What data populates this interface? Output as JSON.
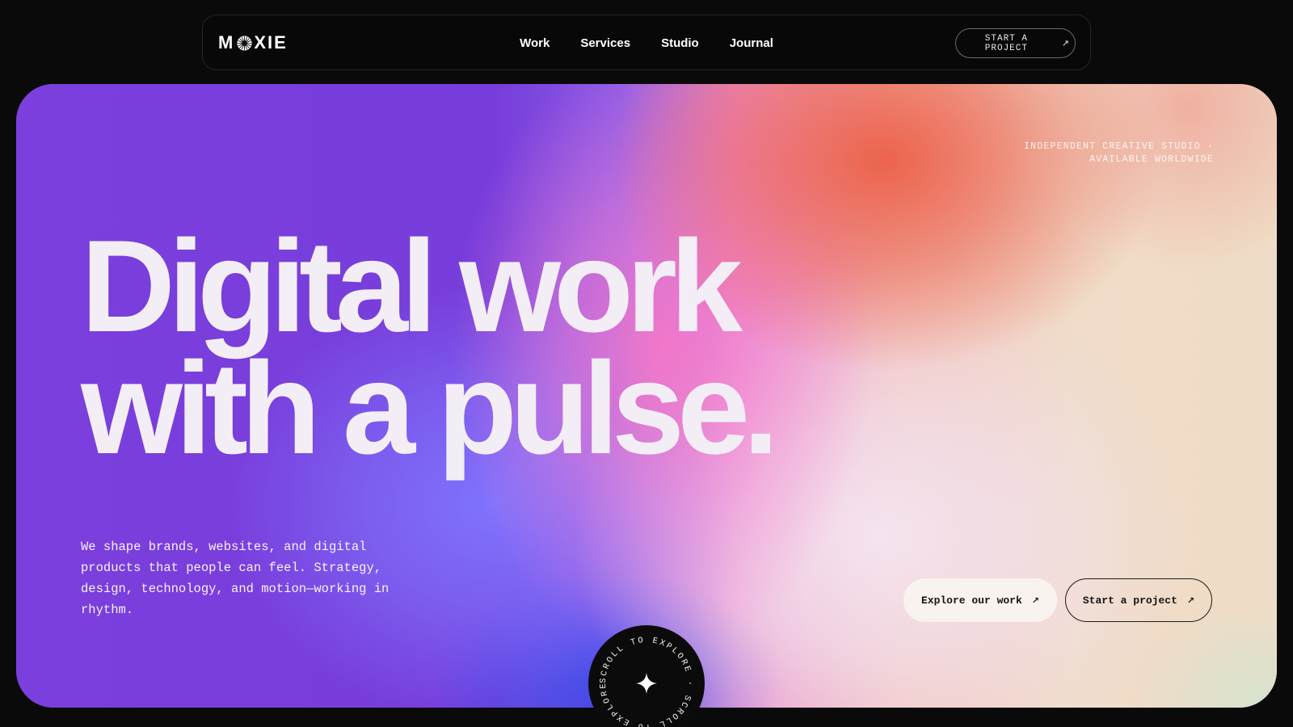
{
  "nav": {
    "logo": {
      "prefix": "M",
      "suffix": "XIE"
    },
    "links": [
      {
        "label": "Work"
      },
      {
        "label": "Services"
      },
      {
        "label": "Studio"
      },
      {
        "label": "Journal"
      }
    ],
    "cta": {
      "label": "START A PROJECT",
      "icon": "arrow-up-right-icon"
    }
  },
  "hero": {
    "tagline": [
      "INDEPENDENT CREATIVE STUDIO ·",
      "AVAILABLE WORLDWIDE"
    ],
    "headline": [
      "Digital work",
      "with a pulse."
    ],
    "intro": "We shape brands, websites, and digital products that people can feel. Strategy, design, technology, and motion—working in rhythm.",
    "primary_button": {
      "label": "Explore our work",
      "icon": "arrow-up-right-icon"
    },
    "secondary_button": {
      "label": "Start a project",
      "icon": "arrow-up-right-icon"
    },
    "scroll_badge": {
      "ring_text": "SCROLL TO EXPLORE · SCROLL TO EXPLORE · ",
      "icon": "sparkle-icon"
    }
  },
  "colors": {
    "page_background": "#0a0a0a",
    "violet": "#7b3fdd",
    "coral": "#ec5e46",
    "pink": "#f57ac8",
    "periwinkle": "#8076ff",
    "cream": "#efdcc6",
    "text_light": "#f3eef5"
  }
}
